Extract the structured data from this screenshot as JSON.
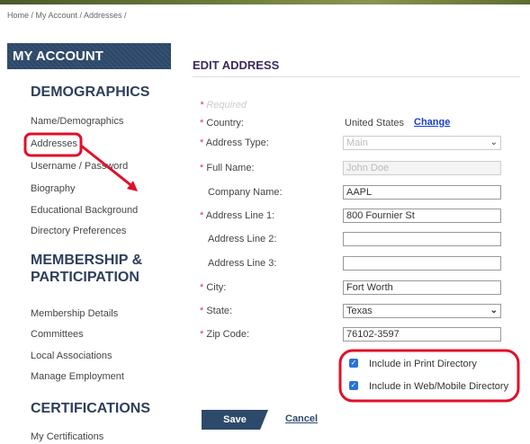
{
  "breadcrumb": "Home / My Account / Addresses /",
  "sidebar": {
    "title": "MY ACCOUNT",
    "sections": [
      {
        "heading": "DEMOGRAPHICS",
        "links": [
          "Name/Demographics",
          "Addresses",
          "Username / Password",
          "Biography",
          "Educational Background",
          "Directory Preferences"
        ]
      },
      {
        "heading": "MEMBERSHIP & PARTICIPATION",
        "links": [
          "Membership Details",
          "Committees",
          "Local Associations",
          "Manage Employment"
        ]
      },
      {
        "heading": "CERTIFICATIONS",
        "links": [
          "My Certifications"
        ]
      }
    ]
  },
  "form": {
    "title": "EDIT ADDRESS",
    "required_note": "Required",
    "star": "*",
    "country": {
      "label": "Country:",
      "value": "United States",
      "change_label": "Change"
    },
    "address_type": {
      "label": "Address Type:",
      "value": "Main"
    },
    "full_name": {
      "label": "Full Name:",
      "value": "John Doe"
    },
    "company_name": {
      "label": "Company Name:",
      "value": "AAPL"
    },
    "address_line_1": {
      "label": "Address Line 1:",
      "value": "800 Fournier St"
    },
    "address_line_2": {
      "label": "Address Line 2:",
      "value": ""
    },
    "address_line_3": {
      "label": "Address Line 3:",
      "value": ""
    },
    "city": {
      "label": "City:",
      "value": "Fort Worth"
    },
    "state": {
      "label": "State:",
      "value": "Texas"
    },
    "zip": {
      "label": "Zip Code:",
      "value": "76102-3597"
    },
    "print_directory": {
      "label": "Include in Print Directory",
      "checked": true
    },
    "web_directory": {
      "label": "Include in Web/Mobile Directory",
      "checked": true
    },
    "save_label": "Save",
    "cancel_label": "Cancel"
  },
  "colors": {
    "annotation": "#e0102a",
    "sidebar_bar": "#2e4a6b",
    "heading": "#2e3f5c",
    "link_blue": "#1a40c8"
  },
  "icons": {
    "select_arrow": "chevron-down-icon",
    "checkbox": "checkbox-checked-icon"
  }
}
